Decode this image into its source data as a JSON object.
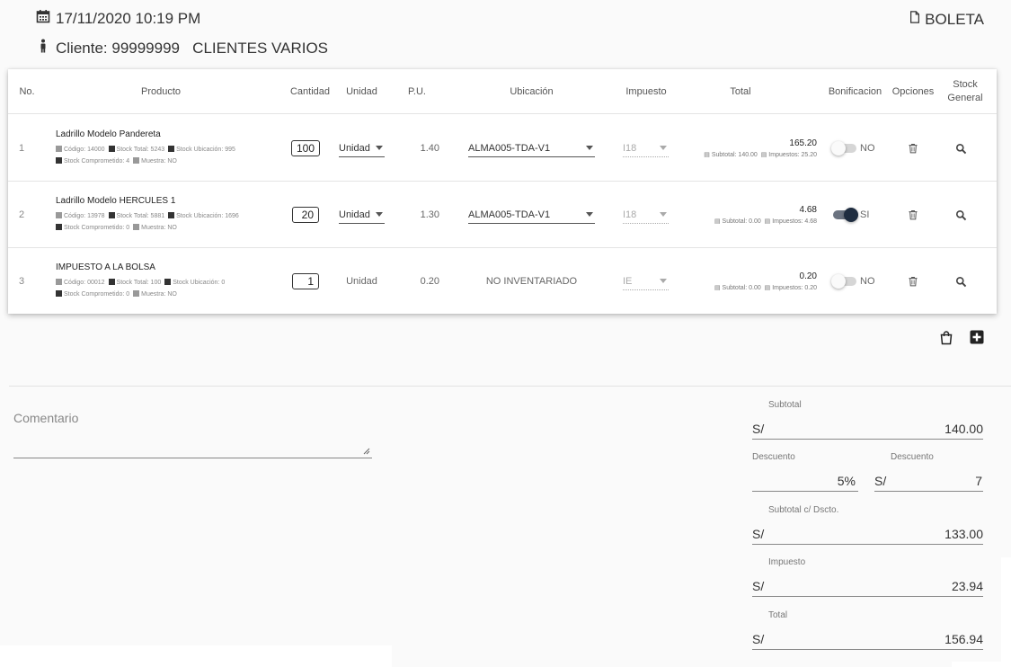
{
  "header": {
    "datetime": "17/11/2020 10:19 PM",
    "client": "Cliente: 99999999   CLIENTES VARIOS",
    "doc_type": "BOLETA"
  },
  "table": {
    "columns": [
      "No.",
      "Producto",
      "Cantidad",
      "Unidad",
      "P.U.",
      "Ubicación",
      "Impuesto",
      "Total",
      "Bonificacion",
      "Opciones",
      "Stock General"
    ],
    "rows": [
      {
        "no": "1",
        "name": "Ladrillo Modelo Pandereta",
        "meta1": [
          "Código: 14000",
          "Stock Total: 5243",
          "Stock Ubicación: 995"
        ],
        "meta2": [
          "Stock Comprometido: 4",
          "Muestra: NO"
        ],
        "qty": "100",
        "unit": "Unidad",
        "pu": "1.40",
        "location": "ALMA005-TDA-V1",
        "tax": "I18",
        "total": "165.20",
        "subtotal": "Subtotal: 140.00",
        "impuestos": "Impuestos: 25.20",
        "bonif": "NO",
        "bonif_on": false
      },
      {
        "no": "2",
        "name": "Ladrillo Modelo HERCULES 1",
        "meta1": [
          "Código: 13978",
          "Stock Total: 5881",
          "Stock Ubicación: 1696"
        ],
        "meta2": [
          "Stock Comprometido: 0",
          "Muestra: NO"
        ],
        "qty": "20",
        "unit": "Unidad",
        "pu": "1.30",
        "location": "ALMA005-TDA-V1",
        "tax": "I18",
        "total": "4.68",
        "subtotal": "Subtotal: 0.00",
        "impuestos": "Impuestos: 4.68",
        "bonif": "SI",
        "bonif_on": true
      },
      {
        "no": "3",
        "name": "IMPUESTO A LA BOLSA",
        "meta1": [
          "Código: 00012",
          "Stock Total: 100",
          "Stock Ubicación: 0"
        ],
        "meta2": [
          "Stock Comprometido: 0",
          "Muestra: NO"
        ],
        "qty": "1",
        "unit": "Unidad",
        "pu": "0.20",
        "location": "NO INVENTARIADO",
        "tax": "IE",
        "total": "0.20",
        "subtotal": "Subtotal: 0.00",
        "impuestos": "Impuestos: 0.20",
        "bonif": "NO",
        "bonif_on": false
      }
    ]
  },
  "comment": {
    "label": "Comentario"
  },
  "summary": {
    "subtotal": {
      "label": "Subtotal",
      "prefix": "S/",
      "value": "140.00"
    },
    "discount_pct": {
      "label": "Descuento",
      "value": "5%"
    },
    "discount_amt": {
      "label": "Descuento",
      "prefix": "S/",
      "value": "7"
    },
    "subtotal_disc": {
      "label": "Subtotal c/ Dscto.",
      "prefix": "S/",
      "value": "133.00"
    },
    "tax": {
      "label": "Impuesto",
      "prefix": "S/",
      "value": "23.94"
    },
    "total": {
      "label": "Total",
      "prefix": "S/",
      "value": "156.94"
    }
  },
  "icons": [
    "calendar-icon",
    "person-icon",
    "file-icon",
    "trash-icon",
    "search-icon",
    "shopping-bag-icon",
    "plus-square-icon"
  ],
  "colors": {
    "toggle_on": "#1f2d40",
    "toggle_track_on": "#6b7380",
    "toggle_off": "#d6d6d6"
  }
}
